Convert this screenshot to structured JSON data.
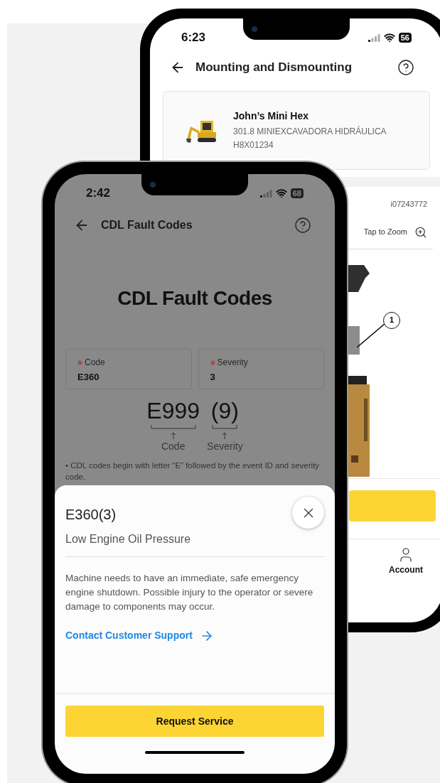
{
  "back_phone": {
    "status_bar": {
      "time": "6:23",
      "battery": "56"
    },
    "header": {
      "title": "Mounting and Dismounting"
    },
    "machine_card": {
      "name": "John’s Mini Hex",
      "model": "301.8 MINIEXCAVADORA HIDRÁULICA",
      "serial": "H8X01234"
    },
    "illustration_id": "i07243772",
    "zoom_hint": "Tap to Zoom",
    "callout": "1",
    "bottom_nav": [
      {
        "label": "Account"
      }
    ]
  },
  "front_phone": {
    "status_bar": {
      "time": "2:42",
      "battery": "68"
    },
    "header": {
      "title": "CDL Fault Codes"
    },
    "page_title": "CDL Fault Codes",
    "fields": [
      {
        "label": "Code",
        "required": true,
        "value": "E360"
      },
      {
        "label": "Severity",
        "required": true,
        "value": "3"
      }
    ],
    "format": {
      "code": "E999",
      "severity": "(9)",
      "code_label": "Code",
      "severity_label": "Severity"
    },
    "note": "• CDL codes begin with letter “E” followed by the event ID and severity code.",
    "sheet": {
      "title": "E360(3)",
      "subtitle": "Low Engine Oil Pressure",
      "description": "Machine needs to have an immediate, safe emergency engine shutdown.  Possible injury to the operator or severe damage to components may occur.",
      "link": "Contact Customer Support",
      "button": "Request Service"
    }
  }
}
